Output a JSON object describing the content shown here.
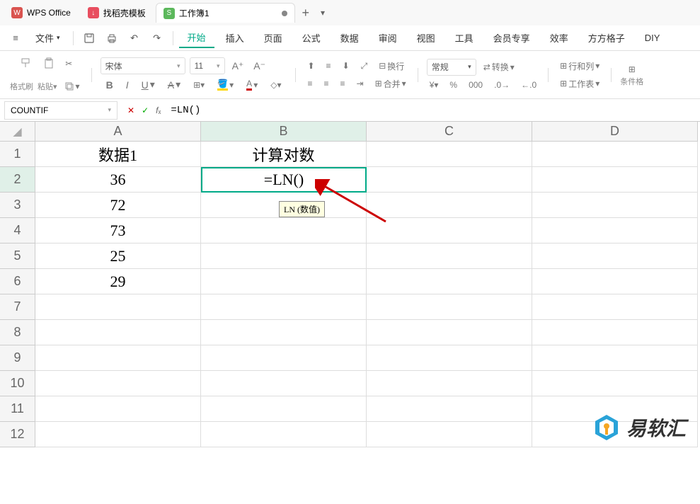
{
  "tabs": [
    {
      "label": "WPS Office",
      "icon_class": "icon-wps",
      "icon_text": "W"
    },
    {
      "label": "找稻壳模板",
      "icon_class": "icon-template",
      "icon_text": "↓"
    },
    {
      "label": "工作簿1",
      "icon_class": "icon-sheet",
      "icon_text": "S",
      "active": true
    }
  ],
  "menu": {
    "file": "文件",
    "items": [
      "开始",
      "插入",
      "页面",
      "公式",
      "数据",
      "审阅",
      "视图",
      "工具",
      "会员专享",
      "效率",
      "方方格子",
      "DIY"
    ],
    "active": "开始"
  },
  "ribbon": {
    "format_painter": "格式刷",
    "paste": "粘贴",
    "font_name": "宋体",
    "font_size": "11",
    "wrap": "换行",
    "merge": "合并",
    "number_format": "常规",
    "convert": "转换",
    "rows_cols": "行和列",
    "worksheet": "工作表",
    "conditional": "条件格"
  },
  "formula_bar": {
    "name_box": "COUNTIF",
    "formula": "=LN()"
  },
  "grid": {
    "columns": [
      "A",
      "B",
      "C",
      "D"
    ],
    "rows": [
      "1",
      "2",
      "3",
      "4",
      "5",
      "6",
      "7",
      "8",
      "9",
      "10",
      "11",
      "12"
    ],
    "active_col": "B",
    "active_row": "2",
    "data": {
      "A1": "数据1",
      "B1": "计算对数",
      "A2": "36",
      "B2": "=LN()",
      "A3": "72",
      "A4": "73",
      "A5": "25",
      "A6": "29"
    },
    "tooltip": "LN (数值)"
  },
  "watermark": "易软汇"
}
